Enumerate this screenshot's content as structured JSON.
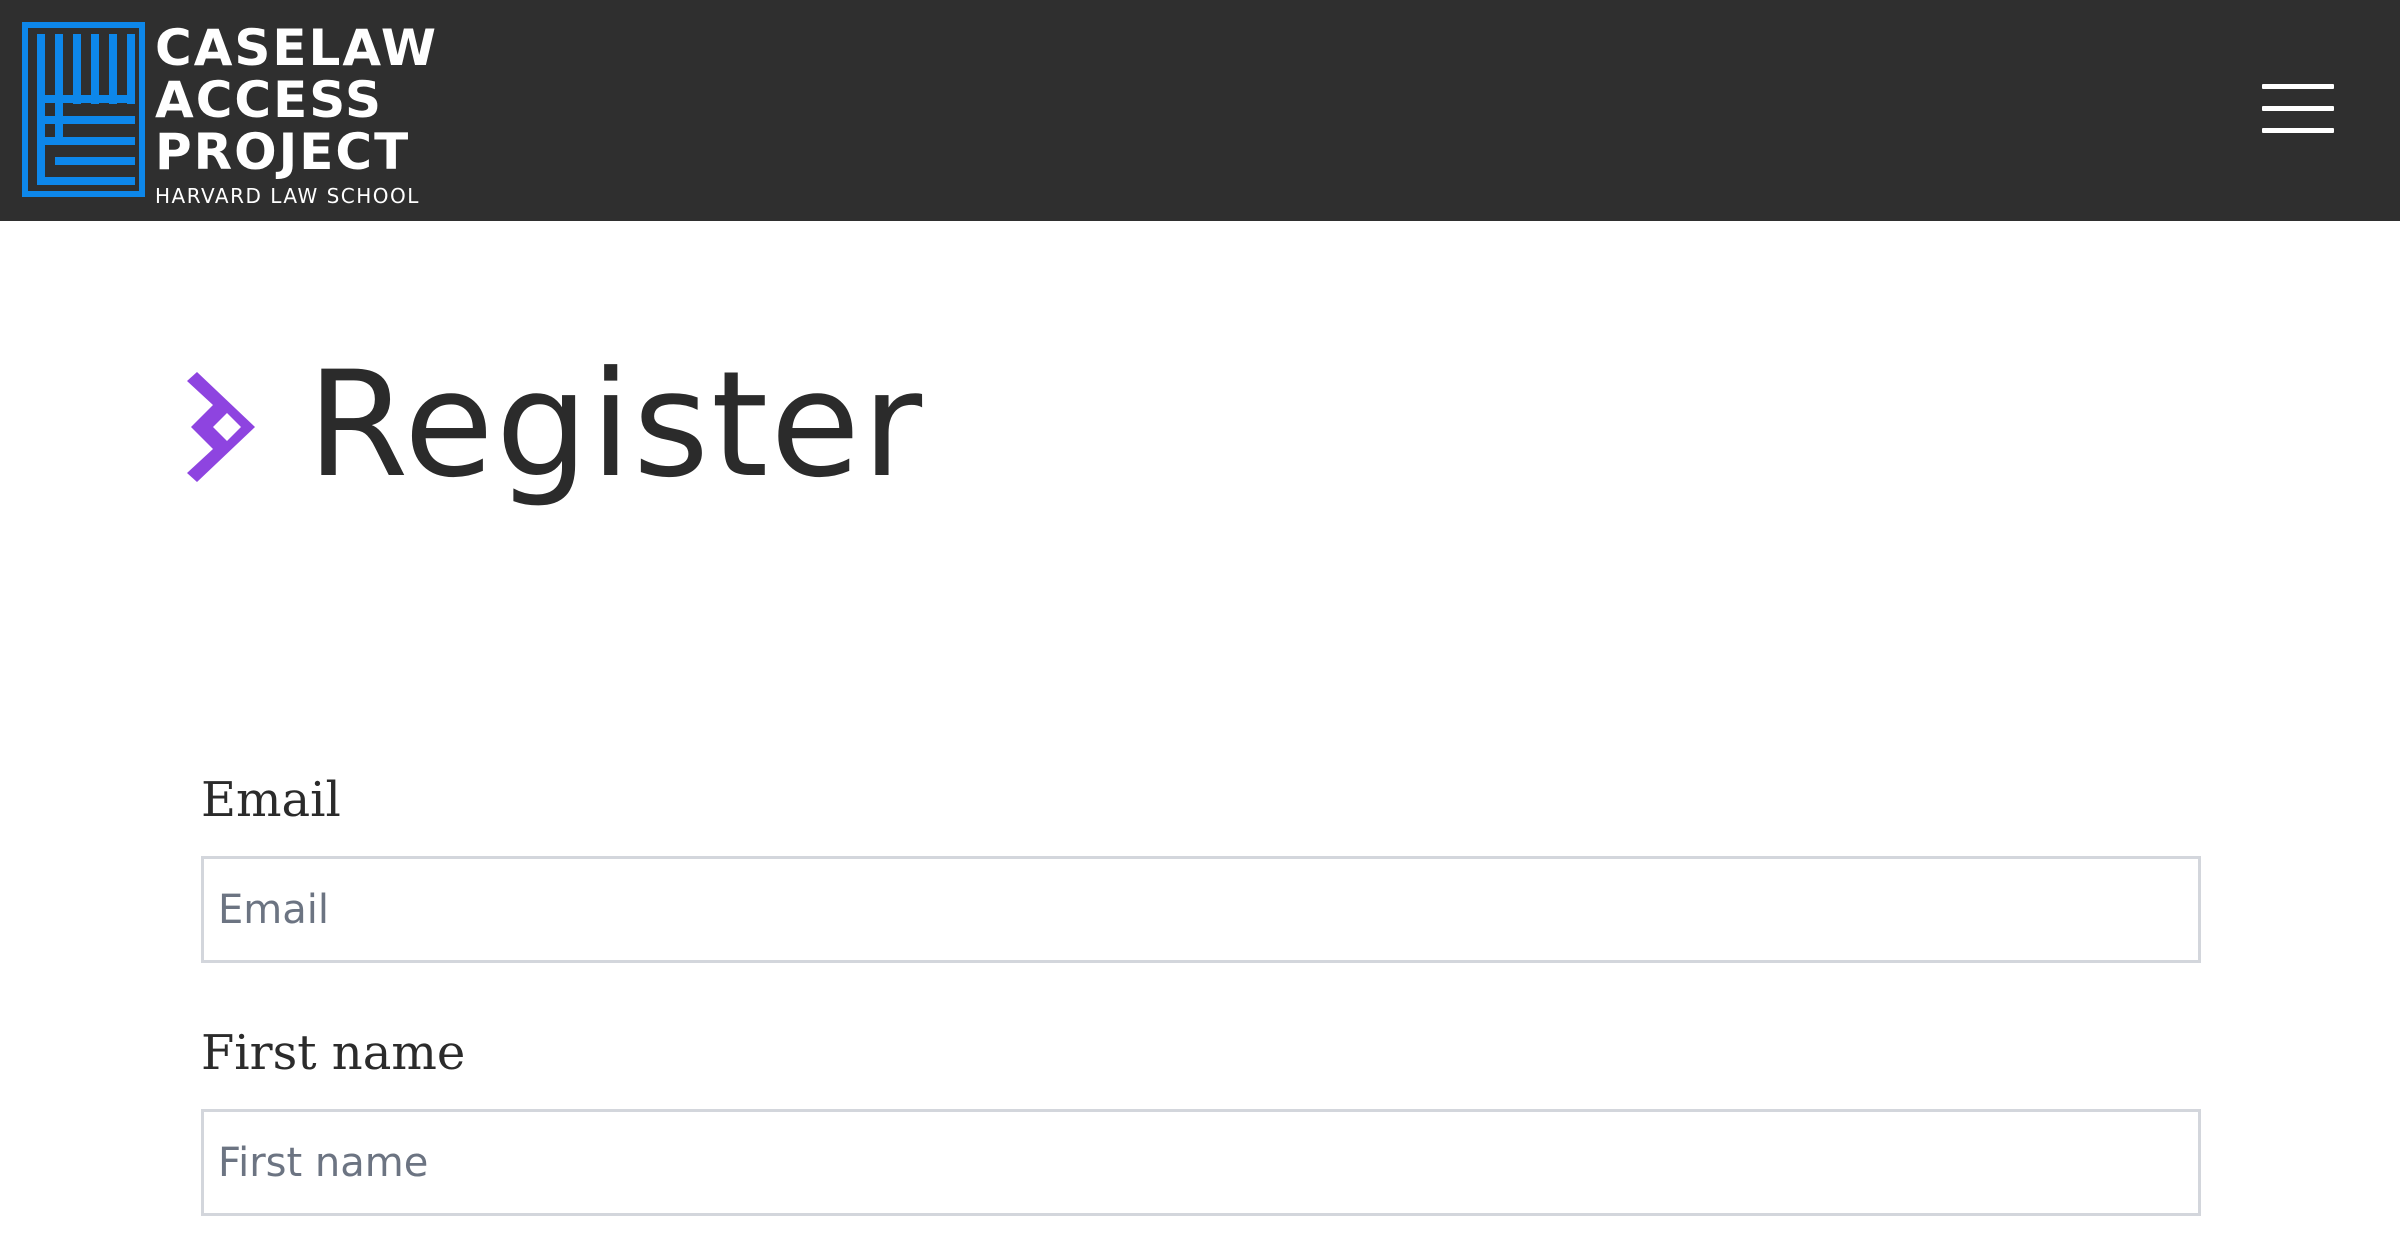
{
  "header": {
    "logo": {
      "lines": [
        "CASELAW",
        "ACCESS",
        "PROJECT"
      ],
      "subtitle": "HARVARD LAW SCHOOL",
      "mark_color": "#0d87ea"
    },
    "background_color": "#2f2f2f",
    "menu_icon": "hamburger-menu-icon"
  },
  "main": {
    "title": "Register",
    "title_icon": "chevron-diamond-icon",
    "accent_color": "#8e44e0"
  },
  "form": {
    "fields": [
      {
        "label": "Email",
        "placeholder": "Email",
        "value": ""
      },
      {
        "label": "First name",
        "placeholder": "First name",
        "value": ""
      }
    ]
  }
}
